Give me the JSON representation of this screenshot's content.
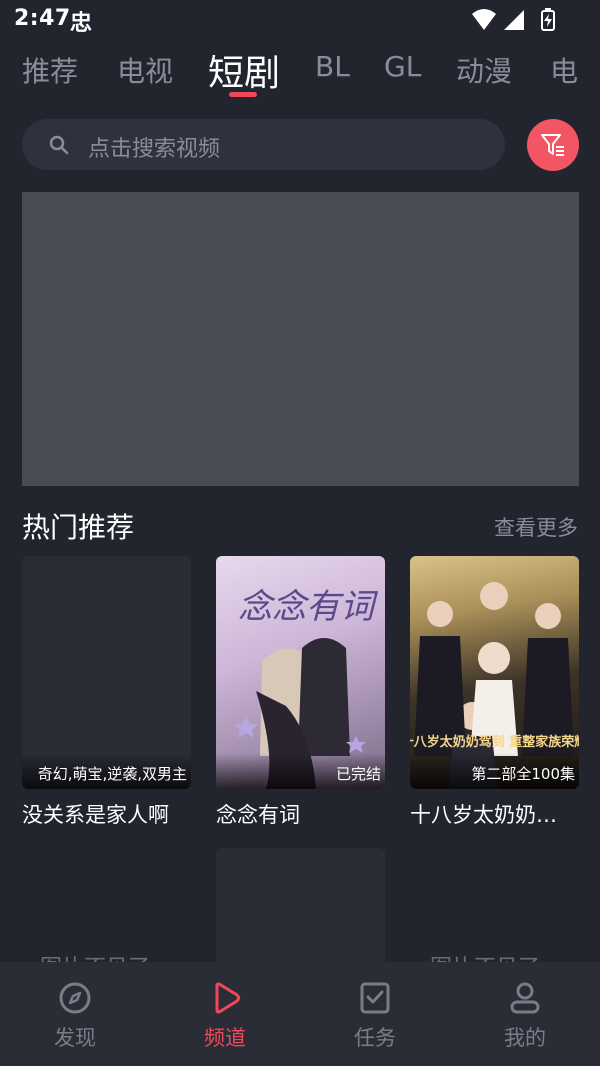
{
  "status_bar": {
    "time": "2:47",
    "app_icon_glyph": "忠",
    "icons": [
      "wifi-icon",
      "signal-icon",
      "battery-charging-icon"
    ]
  },
  "tabs": [
    {
      "label": "推荐",
      "active": false
    },
    {
      "label": "电视",
      "active": false
    },
    {
      "label": "短剧",
      "active": true
    },
    {
      "label": "BL",
      "active": false
    },
    {
      "label": "GL",
      "active": false
    },
    {
      "label": "动漫",
      "active": false
    },
    {
      "label": "电",
      "active": false
    }
  ],
  "search": {
    "placeholder": "点击搜索视频",
    "icon": "search-icon"
  },
  "filter_button": {
    "icon": "filter-icon",
    "color": "#f25563"
  },
  "section": {
    "title": "热门推荐",
    "see_more": "查看更多"
  },
  "cards": [
    {
      "title": "没关系是家人啊",
      "badge": "奇幻,萌宝,逆袭,双男主"
    },
    {
      "title": "念念有词",
      "badge": "已完结",
      "poster_text": "念念有词"
    },
    {
      "title": "十八岁太奶奶…",
      "badge": "第二部全100集",
      "poster_text": "十八岁太奶奶驾到 重整家族荣耀"
    }
  ],
  "broken_image_text": "图片不见了",
  "bottom_nav": [
    {
      "label": "发现",
      "icon": "compass-icon",
      "active": false
    },
    {
      "label": "频道",
      "icon": "play-icon",
      "active": true
    },
    {
      "label": "任务",
      "icon": "task-icon",
      "active": false
    },
    {
      "label": "我的",
      "icon": "user-icon",
      "active": false
    }
  ],
  "colors": {
    "accent": "#f0475b",
    "background": "#22242e",
    "muted_text": "#8a8d99"
  }
}
